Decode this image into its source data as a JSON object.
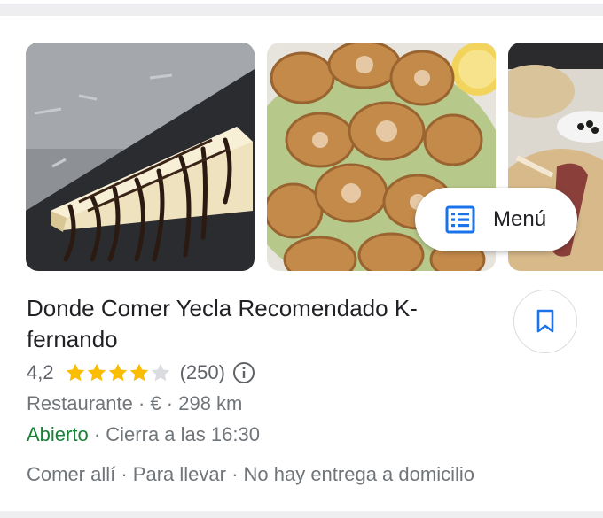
{
  "colors": {
    "star": "#fbbc04",
    "star_empty": "#dadce0",
    "open": "#188038",
    "accent": "#1a73e8",
    "secondary_text": "#70757a"
  },
  "photos": [
    {
      "subject": "cheesecake slice with chocolate sauce"
    },
    {
      "subject": "fried rolls with lettuce and lemon"
    },
    {
      "subject": "flatbread with ham, partially visible"
    }
  ],
  "menu_chip": {
    "label": "Menú",
    "icon": "menu-book-icon"
  },
  "place": {
    "title": "Donde Comer Yecla Recomendado K-fernando",
    "rating": "4,2",
    "stars_filled": 4,
    "stars_total": 5,
    "review_count": "(250)",
    "category": "Restaurante",
    "price": "€",
    "distance": "298 km",
    "separator": " · ",
    "status": "Abierto",
    "closes": "Cierra a las 16:30",
    "services": "Comer allí · Para llevar · No hay entrega a domicilio"
  },
  "save_button": {
    "icon": "bookmark-icon"
  }
}
